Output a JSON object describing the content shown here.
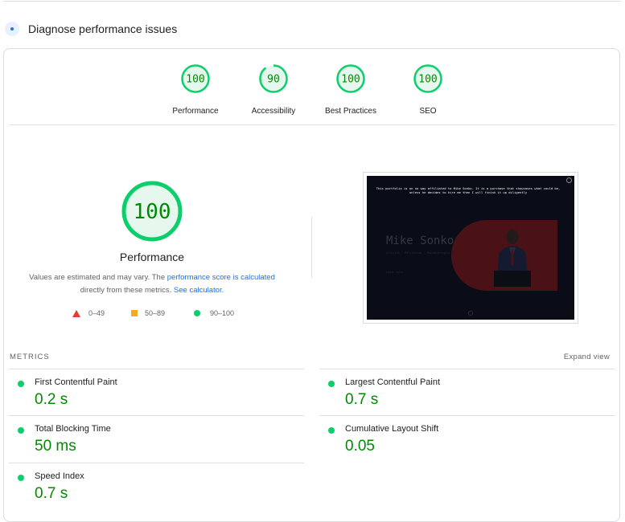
{
  "section": {
    "title": "Diagnose performance issues",
    "icon": "lighthouse-icon"
  },
  "categories": [
    {
      "score": 100,
      "label": "Performance"
    },
    {
      "score": 90,
      "label": "Accessibility"
    },
    {
      "score": 100,
      "label": "Best Practices"
    },
    {
      "score": 100,
      "label": "SEO"
    }
  ],
  "main_score": {
    "score": 100,
    "label": "Performance",
    "note_pre": "Values are estimated and may vary. The ",
    "note_link1": "performance score is calculated",
    "note_mid": " directly from these metrics. ",
    "note_link2": "See calculator."
  },
  "legend": [
    {
      "range": "0–49",
      "shape": "triangle",
      "color": "#e53935"
    },
    {
      "range": "50–89",
      "shape": "square",
      "color": "#f9a825"
    },
    {
      "range": "90–100",
      "shape": "circle",
      "color": "#0cce6b"
    }
  ],
  "screenshot": {
    "banner": "This portfolio is on no way affiliated to Mike Sonko. It is a purchase that showcases what could be, unless he decides to hire me then I will finish it up diligently",
    "name": "Mike Sonko",
    "tagline": "Activist · Politician · Philanthropist",
    "link": "Learn more"
  },
  "metrics": {
    "title": "METRICS",
    "expand_label": "Expand view",
    "items": [
      {
        "name": "First Contentful Paint",
        "value": "0.2 s"
      },
      {
        "name": "Largest Contentful Paint",
        "value": "0.7 s"
      },
      {
        "name": "Total Blocking Time",
        "value": "50 ms"
      },
      {
        "name": "Cumulative Layout Shift",
        "value": "0.05"
      },
      {
        "name": "Speed Index",
        "value": "0.7 s"
      }
    ]
  },
  "colors": {
    "pass": "#0cce6b",
    "pass_text": "#008a00",
    "pass_bg": "#e6f8ee",
    "link": "#1a73e8"
  }
}
